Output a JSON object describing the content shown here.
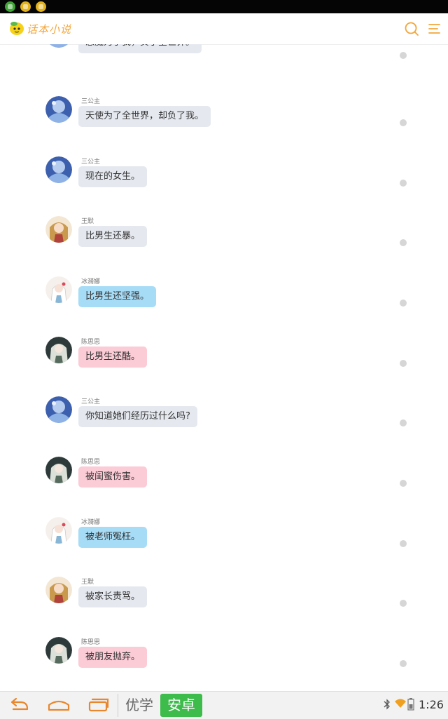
{
  "status_bar": {
    "icons": [
      "wechat-icon",
      "smiley-notification-icon",
      "app-notification-icon"
    ]
  },
  "app_bar": {
    "logo_text": "话本小说",
    "icons": [
      "search-icon",
      "menu-icon"
    ],
    "accent_color": "#f2a63a"
  },
  "bubble_colors": {
    "gray": "#e5e9ef",
    "blue": "#a7dcf7",
    "pink": "#fbcbd6"
  },
  "messages": [
    {
      "name": "",
      "text": "恶魔为了我，负了全世界。",
      "avatar": "san-gong-zhu-avatar"
    },
    {
      "name": "三公主",
      "text": "天使为了全世界，却负了我。",
      "avatar": "san-gong-zhu-avatar"
    },
    {
      "name": "三公主",
      "text": "现在的女生。",
      "avatar": "san-gong-zhu-avatar"
    },
    {
      "name": "王默",
      "text": "比男生还暴。",
      "avatar": "wang-mo-avatar"
    },
    {
      "name": "冰漪娜",
      "text": "比男生还坚强。",
      "avatar": "bing-yi-na-avatar"
    },
    {
      "name": "陈思思",
      "text": "比男生还酷。",
      "avatar": "chen-si-si-avatar"
    },
    {
      "name": "三公主",
      "text": "你知道她们经历过什么吗?",
      "avatar": "san-gong-zhu-avatar"
    },
    {
      "name": "陈思思",
      "text": "被闺蜜伤害。",
      "avatar": "chen-si-si-avatar"
    },
    {
      "name": "冰漪娜",
      "text": "被老师冤枉。",
      "avatar": "bing-yi-na-avatar"
    },
    {
      "name": "王默",
      "text": "被家长责骂。",
      "avatar": "wang-mo-avatar"
    },
    {
      "name": "陈思思",
      "text": "被朋友抛弃。",
      "avatar": "chen-si-si-avatar"
    }
  ],
  "nav_bar": {
    "icons": [
      "back-icon",
      "home-icon",
      "recent-apps-icon"
    ],
    "apps": [
      "优学",
      "安卓"
    ],
    "active_app_color": "#3dbb4b",
    "tray_icons": [
      "bluetooth-icon",
      "wifi-icon",
      "battery-icon"
    ],
    "time": "1:26"
  }
}
